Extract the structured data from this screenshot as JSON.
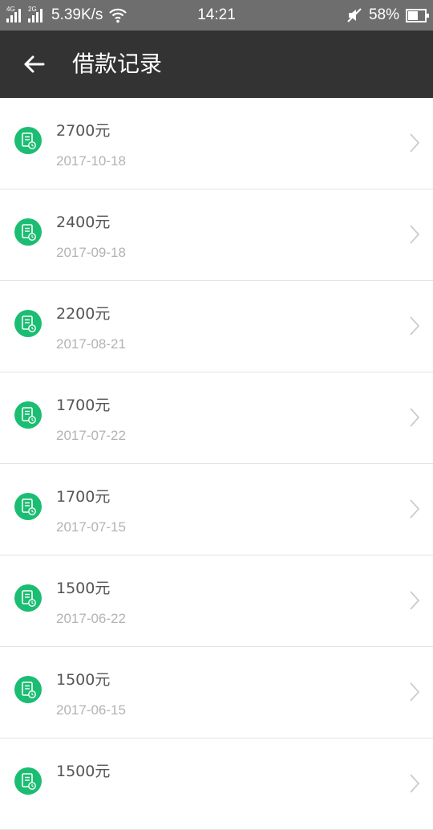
{
  "status_bar": {
    "network1": "4G",
    "network2": "2G",
    "speed": "5.39K/s",
    "time": "14:21",
    "battery_pct": "58%",
    "battery_level": 0.58
  },
  "header": {
    "title": "借款记录"
  },
  "records": [
    {
      "amount": "2700元",
      "date": "2017-10-18"
    },
    {
      "amount": "2400元",
      "date": "2017-09-18"
    },
    {
      "amount": "2200元",
      "date": "2017-08-21"
    },
    {
      "amount": "1700元",
      "date": "2017-07-22"
    },
    {
      "amount": "1700元",
      "date": "2017-07-15"
    },
    {
      "amount": "1500元",
      "date": "2017-06-22"
    },
    {
      "amount": "1500元",
      "date": "2017-06-15"
    },
    {
      "amount": "1500元",
      "date": ""
    }
  ],
  "colors": {
    "accent": "#1bbd72",
    "appbar": "#333333",
    "statusbar": "#6e6e6e"
  }
}
